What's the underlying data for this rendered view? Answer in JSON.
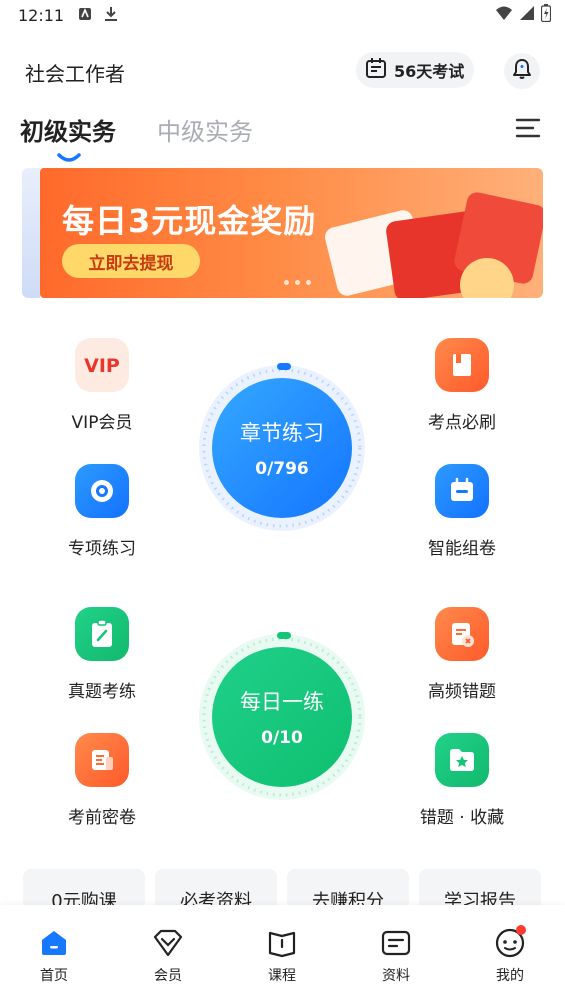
{
  "status_bar": {
    "time": "12:11"
  },
  "header": {
    "title": "社会工作者",
    "exam_countdown": "56天考试"
  },
  "tabs": [
    {
      "label": "初级实务"
    },
    {
      "label": "中级实务"
    }
  ],
  "banner": {
    "headline": "每日3元现金奖励",
    "cta": "立即去提现"
  },
  "features": {
    "vip": "VIP会员",
    "kaodian": "考点必刷",
    "zhuanxiang": "专项练习",
    "zhineng": "智能组卷",
    "zhenti": "真题考练",
    "gaopin": "高频错题",
    "kaoqian": "考前密卷",
    "cuoti": "错题 · 收藏"
  },
  "chapter_practice": {
    "title": "章节练习",
    "progress": "0/796"
  },
  "daily_practice": {
    "title": "每日一练",
    "progress": "0/10"
  },
  "quick_links": [
    {
      "label": "0元购课"
    },
    {
      "label": "必考资料"
    },
    {
      "label": "去赚积分"
    },
    {
      "label": "学习报告"
    }
  ],
  "bottom_nav": [
    {
      "label": "首页"
    },
    {
      "label": "会员"
    },
    {
      "label": "课程"
    },
    {
      "label": "资料"
    },
    {
      "label": "我的"
    }
  ],
  "colors": {
    "primary_blue": "#1677ff",
    "green": "#13c576",
    "orange": "#ff7a2e",
    "badge_red": "#ff3b30"
  }
}
